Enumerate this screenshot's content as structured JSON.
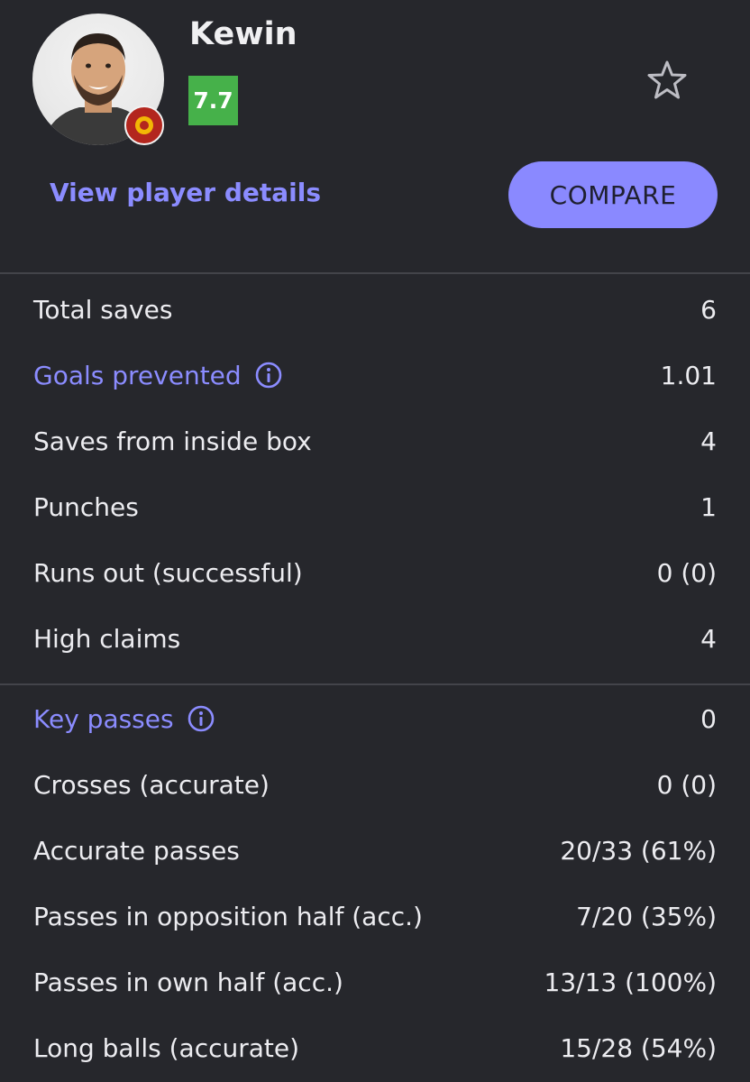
{
  "player": {
    "name": "Kewin",
    "rating": "7.7",
    "details_link": "View player details",
    "compare_label": "COMPARE",
    "rating_color": "#46b14a",
    "accent_color": "#8b8cff"
  },
  "goalkeeping": [
    {
      "label": "Total saves",
      "value": "6",
      "info": false
    },
    {
      "label": "Goals prevented",
      "value": "1.01",
      "info": true
    },
    {
      "label": "Saves from inside box",
      "value": "4",
      "info": false
    },
    {
      "label": "Punches",
      "value": "1",
      "info": false
    },
    {
      "label": "Runs out (successful)",
      "value": "0 (0)",
      "info": false
    },
    {
      "label": "High claims",
      "value": "4",
      "info": false
    }
  ],
  "passing": [
    {
      "label": "Key passes",
      "value": "0",
      "info": true
    },
    {
      "label": "Crosses (accurate)",
      "value": "0 (0)",
      "info": false
    },
    {
      "label": "Accurate passes",
      "value": "20/33 (61%)",
      "info": false
    },
    {
      "label": "Passes in opposition half (acc.)",
      "value": "7/20 (35%)",
      "info": false
    },
    {
      "label": "Passes in own half (acc.)",
      "value": "13/13 (100%)",
      "info": false
    },
    {
      "label": "Long balls (accurate)",
      "value": "15/28 (54%)",
      "info": false
    }
  ],
  "icons": {
    "favorite": "star-outline-icon",
    "info": "info-circle-icon",
    "club": "club-badge-icon"
  }
}
